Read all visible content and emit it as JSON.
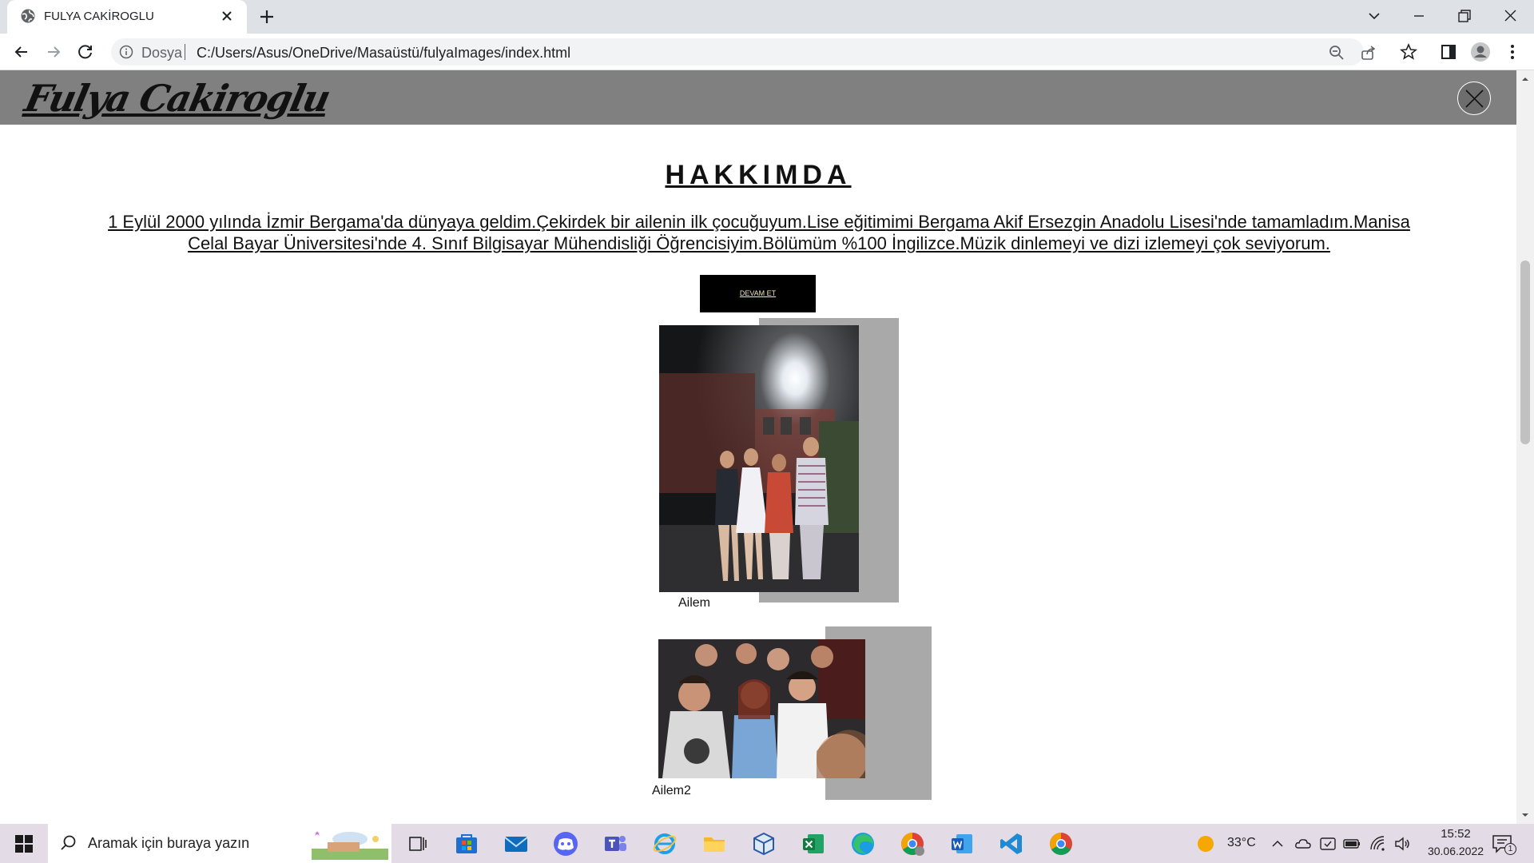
{
  "browser": {
    "tab_title": "FULYA CAKİROGLU",
    "address_scheme": "Dosya",
    "address_url": "C:/Users/Asus/OneDrive/Masaüstü/fulyaImages/index.html"
  },
  "site": {
    "logo_text": "Fulya Cakiroglu",
    "about_title": "HAKKIMDA",
    "about_text": "1 Eylül 2000 yılında İzmir Bergama'da dünyaya geldim.Çekirdek bir ailenin ilk çocuğuyum.Lise eğitimimi Bergama Akif Ersezgin Anadolu Lisesi'nde tamamladım.Manisa Celal Bayar Üniversitesi'nde 4. Sınıf Bilgisayar Mühendisliği Öğrencisiyim.Bölümüm %100 İngilizce.Müzik dinlemeyi ve dizi izlemeyi çok seviyorum.",
    "continue_label": "DEVAM ET",
    "photos": [
      {
        "caption": "Ailem"
      },
      {
        "caption": "Ailem2"
      }
    ]
  },
  "taskbar": {
    "search_placeholder": "Aramak için buraya yazın",
    "weather_temp": "33°C",
    "time": "15:52",
    "date": "30.06.2022",
    "notification_count": "1",
    "apps": [
      "task-view",
      "microsoft-store",
      "mail",
      "discord",
      "teams",
      "internet-explorer",
      "file-explorer",
      "3d-viewer",
      "excel",
      "edge",
      "chrome-profile",
      "word",
      "vscode",
      "chrome"
    ]
  },
  "colors": {
    "header_bg": "#808080",
    "button_bg": "#000000",
    "photo_shadow": "#a9a9a9"
  }
}
